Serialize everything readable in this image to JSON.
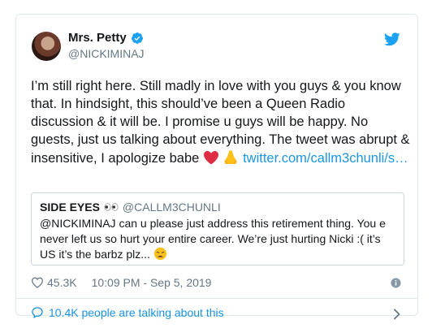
{
  "tweet": {
    "display_name": "Mrs. Petty",
    "handle": "@NICKIMINAJ",
    "text_main": "I’m still right here. Still madly in love with you guys & you know that. In hindsight, this should’ve been a Queen Radio discussion & it will be. I promise u guys will be happy. No guests, just us talking about everything. The tweet was abrupt & insensitive, I apologize babe ",
    "link": "twitter.com/callm3chunli/s…",
    "likes": "45.3K",
    "timestamp": "10:09 PM - Sep 5, 2019",
    "talking": "10.4K people are talking about this"
  },
  "quote": {
    "name": "SIDE EYES",
    "handle": "@CALLM3CHUNLI",
    "text": "@NICKIMINAJ can u please just address this retirement thing. You e never left us so hurt your entire career. We’re just hurting Nicki :( it’s US it’s the barbz plz... "
  },
  "colors": {
    "link": "#1b95e0",
    "text": "#14171a",
    "muted": "#657786",
    "border": "#e1e8ed"
  },
  "icons": {
    "verified": "verified-badge-icon",
    "logo": "twitter-bird-icon",
    "like": "heart-outline-icon",
    "info": "info-icon",
    "reply": "speech-bubble-icon",
    "chevron": "chevron-right-icon"
  }
}
